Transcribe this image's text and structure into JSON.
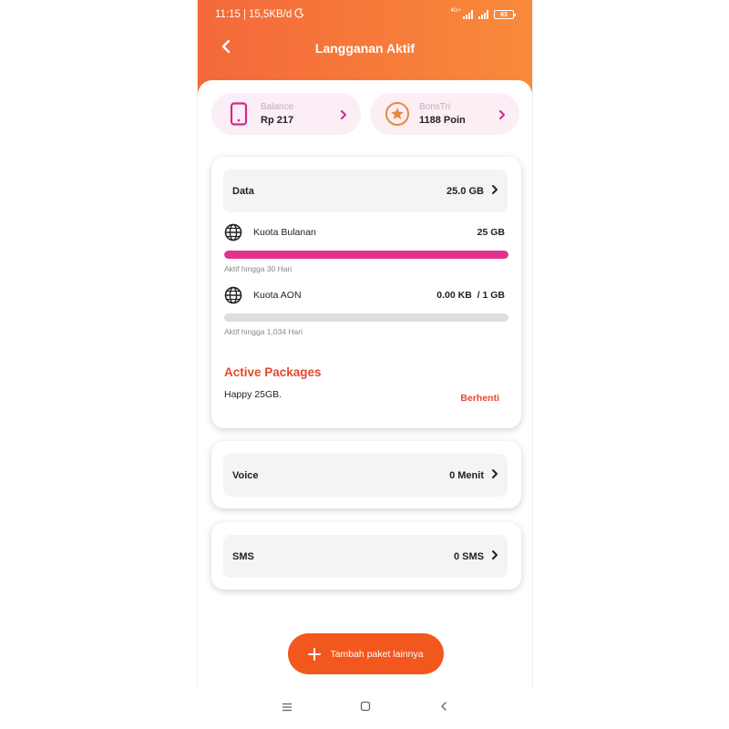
{
  "status_bar": {
    "time": "11:15",
    "network_speed": "15,5KB/d",
    "network_badge": "4G+",
    "battery": "63"
  },
  "header": {
    "title": "Langganan Aktif"
  },
  "balance": {
    "label": "Balance",
    "value": "Rp 217"
  },
  "bonstri": {
    "label": "BonsTri",
    "value": "1188 Poin"
  },
  "data_section": {
    "label": "Data",
    "total": "25.0 GB",
    "quotas": [
      {
        "name": "Kuota Bulanan",
        "amount": "25 GB",
        "remaining_fraction": 1.0,
        "expiry": "Aktif hingga 30 Hari"
      },
      {
        "name": "Kuota AON",
        "amount": "0.00 KB  / 1 GB",
        "remaining_fraction": 0.0,
        "expiry": "Aktif hingga 1,034 Hari"
      }
    ],
    "active_packages_title": "Active Packages",
    "package_name": "Happy 25GB.",
    "stop_label": "Berhenti"
  },
  "voice_section": {
    "label": "Voice",
    "value": "0 Menit"
  },
  "sms_section": {
    "label": "SMS",
    "value": "0 SMS"
  },
  "add_button": {
    "label": "Tambah paket lainnya"
  },
  "icons": {
    "back": "chevron-left-icon",
    "balance": "phone-icon",
    "bonstri": "star-circle-icon",
    "quota": "globe-icon",
    "add": "plus-icon"
  },
  "colors": {
    "header_start": "#f4683a",
    "header_end": "#f98a3a",
    "accent_pink": "#e2328b",
    "accent_orange": "#f2571e",
    "package_title": "#e24a2d",
    "bonstri_star": "#e8893a"
  }
}
